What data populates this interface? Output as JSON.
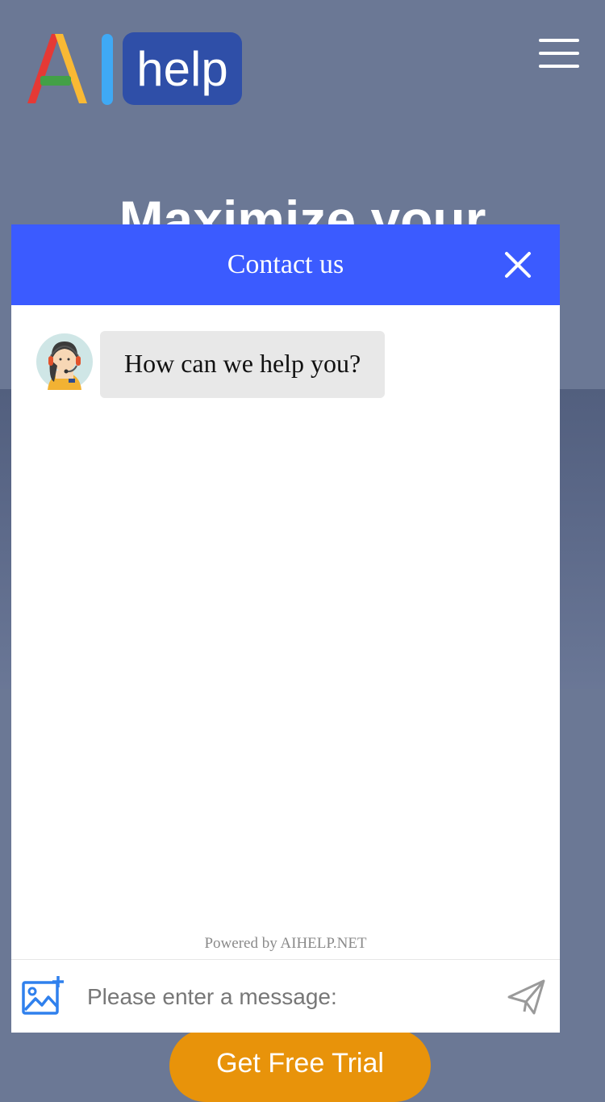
{
  "site": {
    "logo_text": "help",
    "hero_title": "Maximize your",
    "cta_label": "Get Free Trial"
  },
  "chat": {
    "title": "Contact us",
    "messages": [
      {
        "sender": "agent",
        "text": "How can we help you?"
      }
    ],
    "powered_by": "Powered by AIHELP.NET",
    "input_placeholder": "Please enter a message:"
  },
  "colors": {
    "header_blue": "#3b5bff",
    "cta_orange": "#e8930a",
    "page_overlay": "#6b7895",
    "logo_box": "#2f4fa8"
  },
  "icons": [
    "menu-icon",
    "close-icon",
    "agent-avatar-icon",
    "image-upload-icon",
    "send-icon"
  ]
}
